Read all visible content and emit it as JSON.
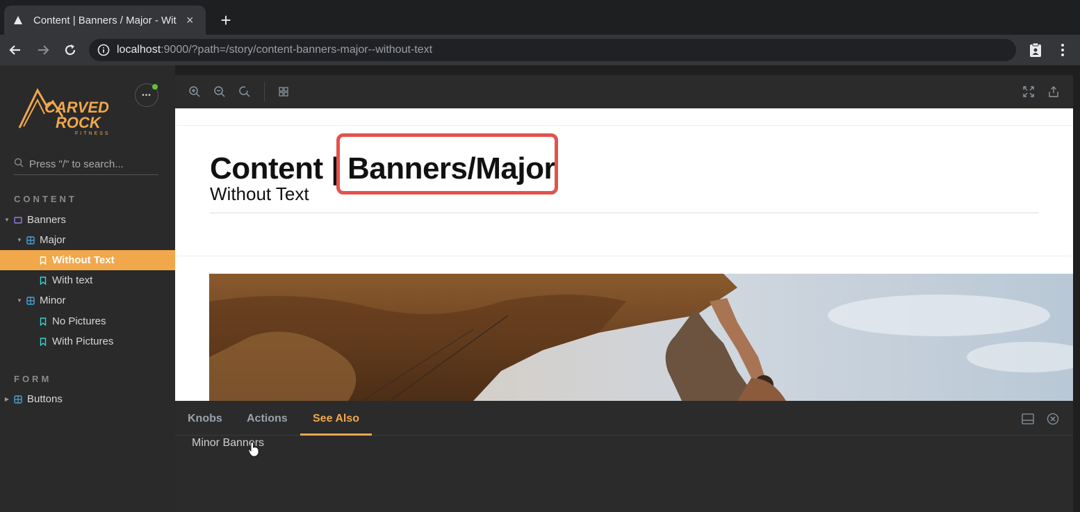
{
  "browser": {
    "tab_title": "Content | Banners / Major - Wit",
    "tab_close": "×",
    "new_tab": "+",
    "url_host": "localhost",
    "url_rest": ":9000/?path=/story/content-banners-major--without-text"
  },
  "sidebar": {
    "logo_text": "CARVED ROCK",
    "logo_sub": "FITNESS",
    "menu_label": "•••",
    "search_placeholder": "Press \"/\" to search...",
    "sections": [
      {
        "title": "CONTENT",
        "items": [
          {
            "label": "Banners",
            "icon": "folder-icon"
          },
          {
            "label": "Major",
            "icon": "component-icon"
          },
          {
            "label": "Without Text",
            "icon": "bookmark-icon",
            "active": true
          },
          {
            "label": "With text",
            "icon": "bookmark-icon"
          },
          {
            "label": "Minor",
            "icon": "component-icon"
          },
          {
            "label": "No Pictures",
            "icon": "bookmark-icon"
          },
          {
            "label": "With Pictures",
            "icon": "bookmark-icon"
          }
        ]
      },
      {
        "title": "FORM",
        "items": [
          {
            "label": "Buttons",
            "icon": "component-icon"
          }
        ]
      }
    ]
  },
  "preview": {
    "title": "Content | Banners/Major",
    "subtitle": "Without Text"
  },
  "addons": {
    "tabs": [
      "Knobs",
      "Actions",
      "See Also"
    ],
    "active_tab": "See Also",
    "content": "Minor Banners"
  },
  "colors": {
    "accent": "#f1a84b",
    "highlight_box": "#e2524b",
    "sidebar_bg": "#2a2a2a",
    "status_dot": "#66bf3c"
  }
}
